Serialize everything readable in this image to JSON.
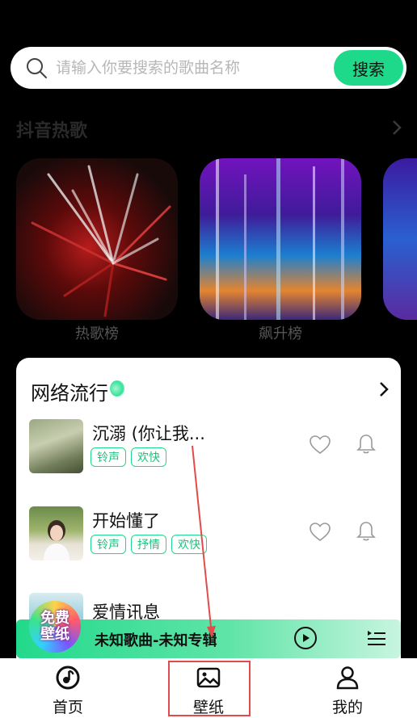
{
  "search": {
    "placeholder": "请输入你要搜索的歌曲名称",
    "button_label": "搜索"
  },
  "hot_section": {
    "title": "抖音热歌",
    "cards": [
      {
        "label": "热歌榜"
      },
      {
        "label": "飙升榜"
      },
      {
        "label": ""
      }
    ]
  },
  "panel": {
    "title": "网络流行",
    "songs": [
      {
        "title": "沉溺 (你让我...",
        "tags": [
          "铃声",
          "欢快"
        ]
      },
      {
        "title": "开始懂了",
        "tags": [
          "铃声",
          "抒情",
          "欢快"
        ]
      },
      {
        "title": "爱情讯息",
        "tags": []
      }
    ]
  },
  "player": {
    "now_playing": "未知歌曲-未知专辑",
    "badge_line1": "免费",
    "badge_line2": "壁纸"
  },
  "nav": {
    "items": [
      {
        "label": "首页"
      },
      {
        "label": "壁纸"
      },
      {
        "label": "我的"
      }
    ]
  },
  "colors": {
    "accent": "#1fd98a",
    "annotation": "#e24b4b"
  }
}
